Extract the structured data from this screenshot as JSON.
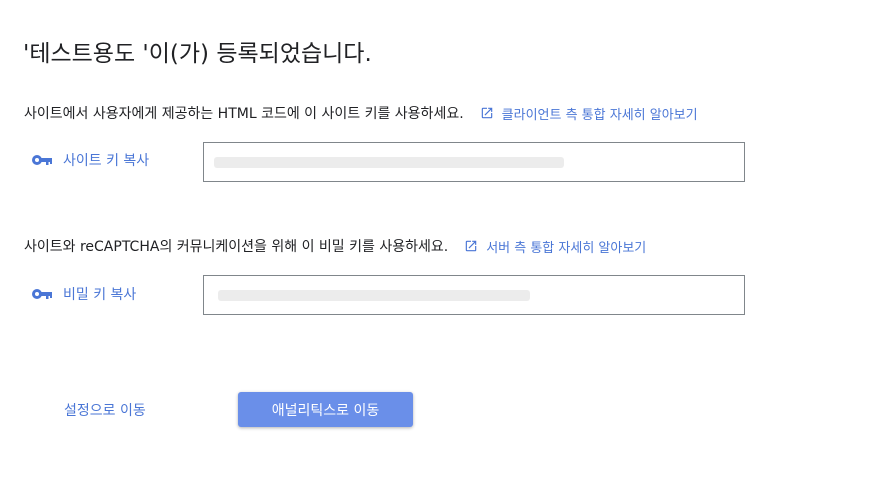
{
  "page_title": "'테스트용도 '이(가) 등록되었습니다.",
  "site_key_section": {
    "description": "사이트에서 사용자에게 제공하는 HTML 코드에 이 사이트 키를 사용하세요.",
    "learn_more": "클라이언트 측 통합 자세히 알아보기",
    "copy_label": "사이트 키 복사"
  },
  "secret_key_section": {
    "description": "사이트와 reCAPTCHA의 커뮤니케이션을 위해 이 비밀 키를 사용하세요.",
    "learn_more": "서버 측 통합 자세히 알아보기",
    "copy_label": "비밀 키 복사"
  },
  "footer": {
    "settings_link": "설정으로 이동",
    "analytics_button": "애널리틱스로 이동"
  },
  "icons": {
    "open_in_new": "open-in-new-icon",
    "key": "key-icon"
  },
  "colors": {
    "accent": "#4a76d6",
    "button_bg": "#6a8fe9",
    "text": "#202124",
    "border": "#80868b"
  }
}
